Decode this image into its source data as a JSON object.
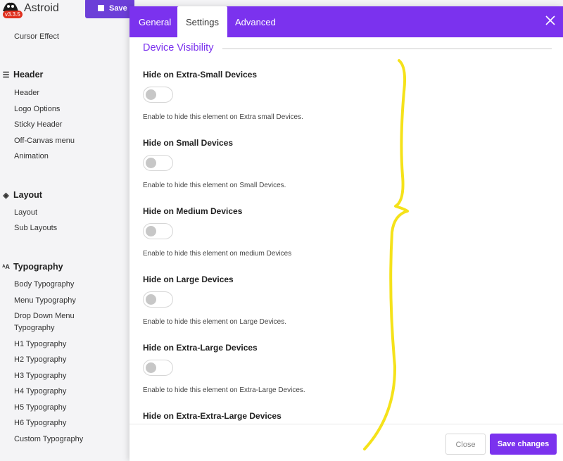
{
  "app": {
    "title": "Astroid",
    "version": "v3.3.5",
    "save_label": "Save"
  },
  "sidebar": {
    "cursor_effect": "Cursor Effect",
    "groups": [
      {
        "heading": "Header",
        "icon": "header-icon",
        "items": [
          "Header",
          "Logo Options",
          "Sticky Header",
          "Off-Canvas menu",
          "Animation"
        ]
      },
      {
        "heading": "Layout",
        "icon": "layers-icon",
        "items": [
          "Layout",
          "Sub Layouts"
        ]
      },
      {
        "heading": "Typography",
        "icon": "font-size-icon",
        "items": [
          "Body Typography",
          "Menu Typography",
          "Drop Down Menu",
          "Typography",
          "H1 Typography",
          "H2 Typography",
          "H3 Typography",
          "H4 Typography",
          "H5 Typography",
          "H6 Typography",
          "Custom Typography"
        ]
      }
    ]
  },
  "modal": {
    "tabs": [
      {
        "label": "General"
      },
      {
        "label": "Settings",
        "active": true
      },
      {
        "label": "Advanced"
      }
    ],
    "section_title": "Device Visibility",
    "options": [
      {
        "title": "Hide on Extra-Small Devices",
        "description": "Enable to hide this element on Extra small Devices.",
        "enabled": false
      },
      {
        "title": "Hide on Small Devices",
        "description": "Enable to hide this element on Small Devices.",
        "enabled": false
      },
      {
        "title": "Hide on Medium Devices",
        "description": "Enable to hide this element on medium Devices",
        "enabled": false
      },
      {
        "title": "Hide on Large Devices",
        "description": "Enable to hide this element on Large Devices.",
        "enabled": false
      },
      {
        "title": "Hide on Extra-Large Devices",
        "description": "Enable to hide this element on Extra-Large Devices.",
        "enabled": false
      },
      {
        "title": "Hide on Extra-Extra-Large Devices",
        "description": "",
        "enabled": false
      }
    ],
    "footer": {
      "close_label": "Close",
      "save_label": "Save changes"
    }
  },
  "colors": {
    "accent": "#7b32ee",
    "annotation": "#f5e21a"
  }
}
